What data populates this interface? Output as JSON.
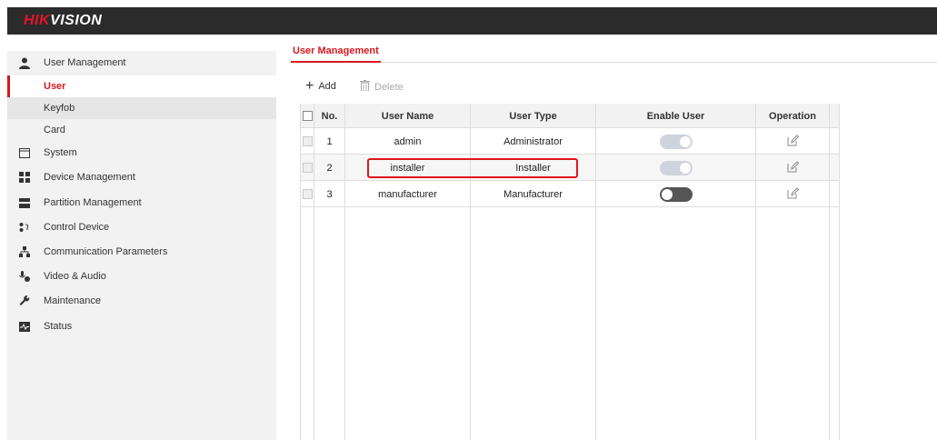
{
  "brand": {
    "logo_red": "HIK",
    "logo_white": "VISION"
  },
  "sidebar": {
    "section_user_management": "User Management",
    "sub_items": [
      {
        "label": "User",
        "active": true
      },
      {
        "label": "Keyfob",
        "active": false
      },
      {
        "label": "Card",
        "active": false
      }
    ],
    "items": [
      {
        "label": "System",
        "icon": "system-icon"
      },
      {
        "label": "Device Management",
        "icon": "device-management-icon"
      },
      {
        "label": "Partition Management",
        "icon": "partition-management-icon"
      },
      {
        "label": "Control Device",
        "icon": "control-device-icon"
      },
      {
        "label": "Communication Parameters",
        "icon": "communication-parameters-icon"
      },
      {
        "label": "Video & Audio",
        "icon": "video-audio-icon"
      },
      {
        "label": "Maintenance",
        "icon": "maintenance-icon"
      },
      {
        "label": "Status",
        "icon": "status-icon"
      }
    ]
  },
  "tab": {
    "label": "User Management"
  },
  "toolbar": {
    "add_label": "Add",
    "delete_label": "Delete"
  },
  "table": {
    "headers": {
      "no": "No.",
      "user_name": "User Name",
      "user_type": "User Type",
      "enable_user": "Enable User",
      "operation": "Operation"
    },
    "rows": [
      {
        "no": "1",
        "user_name": "admin",
        "user_type": "Administrator",
        "enabled": true
      },
      {
        "no": "2",
        "user_name": "installer",
        "user_type": "Installer",
        "enabled": true
      },
      {
        "no": "3",
        "user_name": "manufacturer",
        "user_type": "Manufacturer",
        "enabled": false
      }
    ]
  },
  "colors": {
    "accent": "#d71920",
    "topbar": "#2b2b2b",
    "sidebar_bg": "#f2f2f2"
  }
}
